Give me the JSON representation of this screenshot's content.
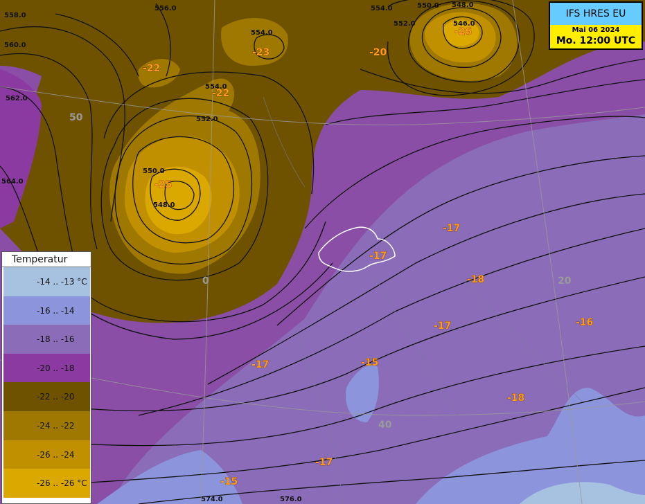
{
  "header": {
    "model": "IFS HRES EU",
    "date": "Mai 06 2024",
    "time": "Mo. 12:00 UTC"
  },
  "legend": {
    "title": "Temperatur",
    "items": [
      {
        "label": "-14 .. -13 °C",
        "color": "#a6c2e0"
      },
      {
        "label": "-16 .. -14",
        "color": "#8c94dc"
      },
      {
        "label": "-18 .. -16",
        "color": "#8a6cb8"
      },
      {
        "label": "-20 .. -18",
        "color": "#8a3aa0"
      },
      {
        "label": "-22 .. -20",
        "color": "#6e5200"
      },
      {
        "label": "-24 .. -22",
        "color": "#9e7800"
      },
      {
        "label": "-26 .. -24",
        "color": "#c09000"
      },
      {
        "label": "-26 .. -26 °C",
        "color": "#dba800"
      }
    ]
  },
  "isolines": [
    "558.0",
    "560.0",
    "562.0",
    "564.0",
    "556.0",
    "554.0",
    "554.0",
    "552.0",
    "550.0",
    "548.0",
    "554.0",
    "552.0",
    "550.0",
    "548.0",
    "546.0",
    "574.0",
    "576.0"
  ],
  "temperatures": [
    "-22",
    "-23",
    "-22",
    "-25",
    "-26",
    "-20",
    "-17",
    "-17",
    "-18",
    "-17",
    "-16",
    "-15",
    "-17",
    "-18",
    "-17",
    "-15"
  ],
  "grid_labels": [
    "50",
    "0",
    "20",
    "40"
  ]
}
